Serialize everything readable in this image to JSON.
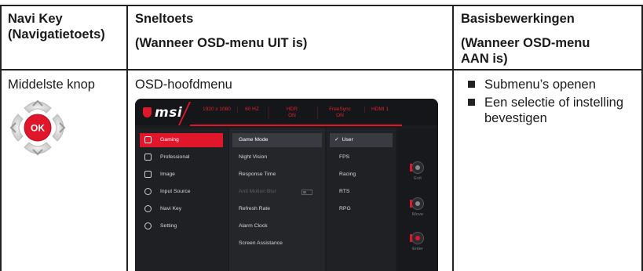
{
  "header": {
    "col1": [
      "Navi Key",
      "(Navigatietoets)"
    ],
    "col2": [
      "Sneltoets",
      "(Wanneer OSD-menu UIT is)"
    ],
    "col3": [
      "Basisbewerkingen",
      "(Wanneer OSD-menu",
      "AAN is)"
    ]
  },
  "row": {
    "col1": "Middelste knop",
    "col2": "OSD-hoofdmenu",
    "col3_bullets": [
      "Submenu’s openen",
      "Een selectie of instelling bevestigen"
    ]
  },
  "navikey": {
    "center_label": "OK"
  },
  "osd": {
    "brand": "msi",
    "status": [
      {
        "line1": "1920 x 1080",
        "line2": ""
      },
      {
        "line1": "60 HZ",
        "line2": ""
      },
      {
        "line1": "HDR",
        "line2": "ON"
      },
      {
        "line1": "FreeSync",
        "line2": "ON"
      },
      {
        "line1": "HDMI 1",
        "line2": ""
      }
    ],
    "menu": [
      {
        "label": "Gaming",
        "icon": "gamepad-icon",
        "selected": true
      },
      {
        "label": "Professional",
        "icon": "star-icon",
        "selected": false
      },
      {
        "label": "Image",
        "icon": "image-icon",
        "selected": false
      },
      {
        "label": "Input Source",
        "icon": "input-icon",
        "selected": false
      },
      {
        "label": "Navi Key",
        "icon": "navi-key-icon",
        "selected": false
      },
      {
        "label": "Setting",
        "icon": "gear-icon",
        "selected": false
      }
    ],
    "submenu": [
      {
        "label": "Game Mode",
        "state": "selected"
      },
      {
        "label": "Night Vision",
        "state": "normal"
      },
      {
        "label": "Response Time",
        "state": "normal"
      },
      {
        "label": "Anti Motion Blur",
        "state": "disabled"
      },
      {
        "label": "Refresh Rate",
        "state": "normal"
      },
      {
        "label": "Alarm Clock",
        "state": "normal"
      },
      {
        "label": "Screen Assistance",
        "state": "normal"
      }
    ],
    "options": [
      {
        "label": "User",
        "selected": true
      },
      {
        "label": "FPS",
        "selected": false
      },
      {
        "label": "Racing",
        "selected": false
      },
      {
        "label": "RTS",
        "selected": false
      },
      {
        "label": "RPG",
        "selected": false
      }
    ],
    "check_mark": "✓",
    "buttons": [
      "Exit",
      "Move",
      "Enter"
    ],
    "accent": "#e0162a"
  }
}
